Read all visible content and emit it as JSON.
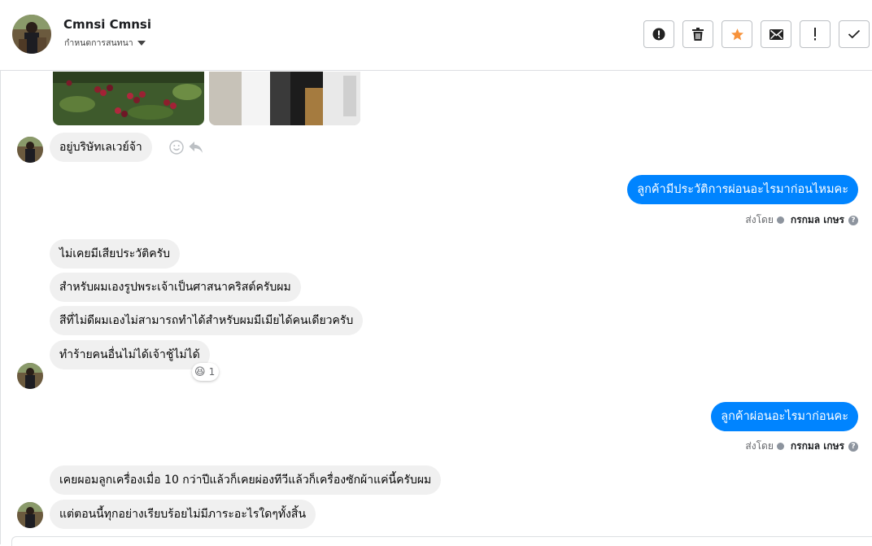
{
  "header": {
    "contact_name": "Cmnsi Cmnsi",
    "subtitle": "กำหนดการสนทนา",
    "toolbar": [
      {
        "name": "report-button",
        "icon": "alert-circle-icon"
      },
      {
        "name": "delete-button",
        "icon": "trash-icon"
      },
      {
        "name": "star-button",
        "icon": "star-icon"
      },
      {
        "name": "mark-unread-button",
        "icon": "envelope-icon"
      },
      {
        "name": "important-button",
        "icon": "exclamation-icon"
      },
      {
        "name": "done-button",
        "icon": "check-icon"
      }
    ]
  },
  "messages": {
    "m1": "อยู่บริษัทเลเวย์จ้า",
    "m2": "ลูกค้ามีประวัติการผ่อนอะไรมาก่อนไหมคะ",
    "m3": "ไม่เคยมีเสียประวัติครับ",
    "m4": "สำหรับผมเองรูปพระเจ้าเป็นศาสนาคริสต์ครับผม",
    "m5": "สีที่ไม่ดีผมเองไม่สามารถทำได้สำหรับผมมีเมียได้คนเดียวครับ",
    "m6": "ทำร้ายคนอื่นไม่ได้เจ้าชู้ไม่ได้",
    "m7": "ลูกค้าผ่อนอะไรมาก่อนคะ",
    "m8": "เคยผอมลูกเครื่องเมื่อ 10 กว่าปีแล้วก็เคยผ่องทีวีแล้วก็เครื่องซักผ้าแค่นี้ครับผม",
    "m9": "แต่ตอนนี้ทุกอย่างเรียบร้อยไม่มีภาระอะไรใดๆทั้งสิ้น"
  },
  "sent_by": {
    "prefix": "ส่งโดย",
    "name": "กรกมล เกษร"
  },
  "reaction": {
    "emoji": "😆",
    "count": "1"
  },
  "colors": {
    "outgoing_bubble": "#0084ff",
    "incoming_bubble": "#f0f0f0",
    "star": "#f7923a"
  }
}
